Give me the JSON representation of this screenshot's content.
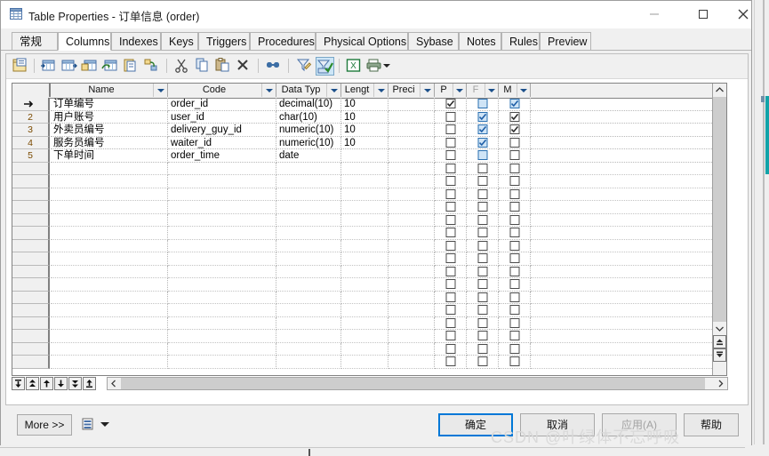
{
  "window": {
    "title": "Table Properties - 订单信息 (order)",
    "icon": "table-icon",
    "controls": {
      "minimize": "minimize-icon",
      "maximize": "maximize-icon",
      "close": "close-icon"
    }
  },
  "tabs": [
    {
      "label": "常规",
      "active": false
    },
    {
      "label": "Columns",
      "active": true
    },
    {
      "label": "Indexes",
      "active": false
    },
    {
      "label": "Keys",
      "active": false
    },
    {
      "label": "Triggers",
      "active": false
    },
    {
      "label": "Procedures",
      "active": false
    },
    {
      "label": "Physical Options",
      "active": false
    },
    {
      "label": "Sybase",
      "active": false
    },
    {
      "label": "Notes",
      "active": false
    },
    {
      "label": "Rules",
      "active": false
    },
    {
      "label": "Preview",
      "active": false
    }
  ],
  "toolbar": {
    "items": [
      {
        "name": "properties-icon",
        "selected": false
      },
      {
        "name": "insert-row-icon",
        "selected": false
      },
      {
        "name": "add-row-icon",
        "selected": false
      },
      {
        "name": "add-column-icon",
        "selected": false
      },
      {
        "name": "reuse-column-icon",
        "selected": false
      },
      {
        "name": "copy-object-icon",
        "selected": false
      },
      {
        "name": "mapping-icon",
        "selected": false
      },
      {
        "name": "cut-icon",
        "selected": false
      },
      {
        "name": "copy-icon",
        "selected": false
      },
      {
        "name": "paste-icon",
        "selected": false
      },
      {
        "name": "delete-icon",
        "selected": false
      },
      {
        "name": "find-icon",
        "selected": false
      },
      {
        "name": "filter-icon",
        "selected": false
      },
      {
        "name": "apply-filter-icon",
        "selected": true
      },
      {
        "name": "export-excel-icon",
        "selected": false
      },
      {
        "name": "print-icon",
        "selected": false
      },
      {
        "name": "print-dropdown-caret",
        "selected": false
      }
    ]
  },
  "grid": {
    "columns": [
      {
        "key": "name",
        "label": "Name",
        "dimmed": false
      },
      {
        "key": "code",
        "label": "Code",
        "dimmed": false
      },
      {
        "key": "type",
        "label": "Data Typ",
        "dimmed": false
      },
      {
        "key": "length",
        "label": "Lengt",
        "dimmed": false
      },
      {
        "key": "prec",
        "label": "Preci",
        "dimmed": false
      },
      {
        "key": "p",
        "label": "P",
        "dimmed": false
      },
      {
        "key": "f",
        "label": "F",
        "dimmed": true
      },
      {
        "key": "m",
        "label": "M",
        "dimmed": false
      }
    ],
    "rows": [
      {
        "num": "",
        "current": true,
        "name": "订单编号",
        "code": "order_id",
        "type": "decimal(10)",
        "length": "10",
        "prec": "",
        "p": "checked",
        "f": "highlighted",
        "m": "checked-highlighted"
      },
      {
        "num": "2",
        "current": false,
        "name": "用户账号",
        "code": "user_id",
        "type": "char(10)",
        "length": "10",
        "prec": "",
        "p": "unchecked",
        "f": "checked-highlighted",
        "m": "checked"
      },
      {
        "num": "3",
        "current": false,
        "name": "外卖员编号",
        "code": "delivery_guy_id",
        "type": "numeric(10)",
        "length": "10",
        "prec": "",
        "p": "unchecked",
        "f": "checked-highlighted",
        "m": "checked"
      },
      {
        "num": "4",
        "current": false,
        "name": "服务员编号",
        "code": "waiter_id",
        "type": "numeric(10)",
        "length": "10",
        "prec": "",
        "p": "unchecked",
        "f": "checked-highlighted",
        "m": "unchecked"
      },
      {
        "num": "5",
        "current": false,
        "name": "下单时间",
        "code": "order_time",
        "type": "date",
        "length": "",
        "prec": "",
        "p": "unchecked",
        "f": "highlighted",
        "m": "unchecked"
      }
    ],
    "empty_row_count": 16
  },
  "row_nav": {
    "buttons": [
      {
        "name": "move-to-first-button"
      },
      {
        "name": "move-up-fast-button"
      },
      {
        "name": "move-up-button"
      },
      {
        "name": "move-down-button"
      },
      {
        "name": "move-down-fast-button"
      },
      {
        "name": "move-to-last-button"
      }
    ]
  },
  "scrollbars": {
    "vertical": {
      "up": "scroll-up-arrow",
      "down": "scroll-down-arrow",
      "top_row": "go-top-button",
      "bottom_row": "go-bottom-button"
    },
    "horizontal": {
      "left": "scroll-left-arrow",
      "right": "scroll-right-arrow"
    }
  },
  "footer": {
    "more": "More >>",
    "menu_icon": "list-report-icon",
    "menu_caret": "dropdown-caret",
    "ok": "确定",
    "cancel": "取消",
    "apply": "应用(A)",
    "help": "帮助"
  },
  "watermark": "CSDN @叶绿体不忘呼吸",
  "colors": {
    "accent": "#0078d7",
    "selection": "#cfe4f6",
    "teal": "#12a3a8",
    "title_bg": "#ffffff",
    "dialog_bg": "#f0f0f0"
  }
}
